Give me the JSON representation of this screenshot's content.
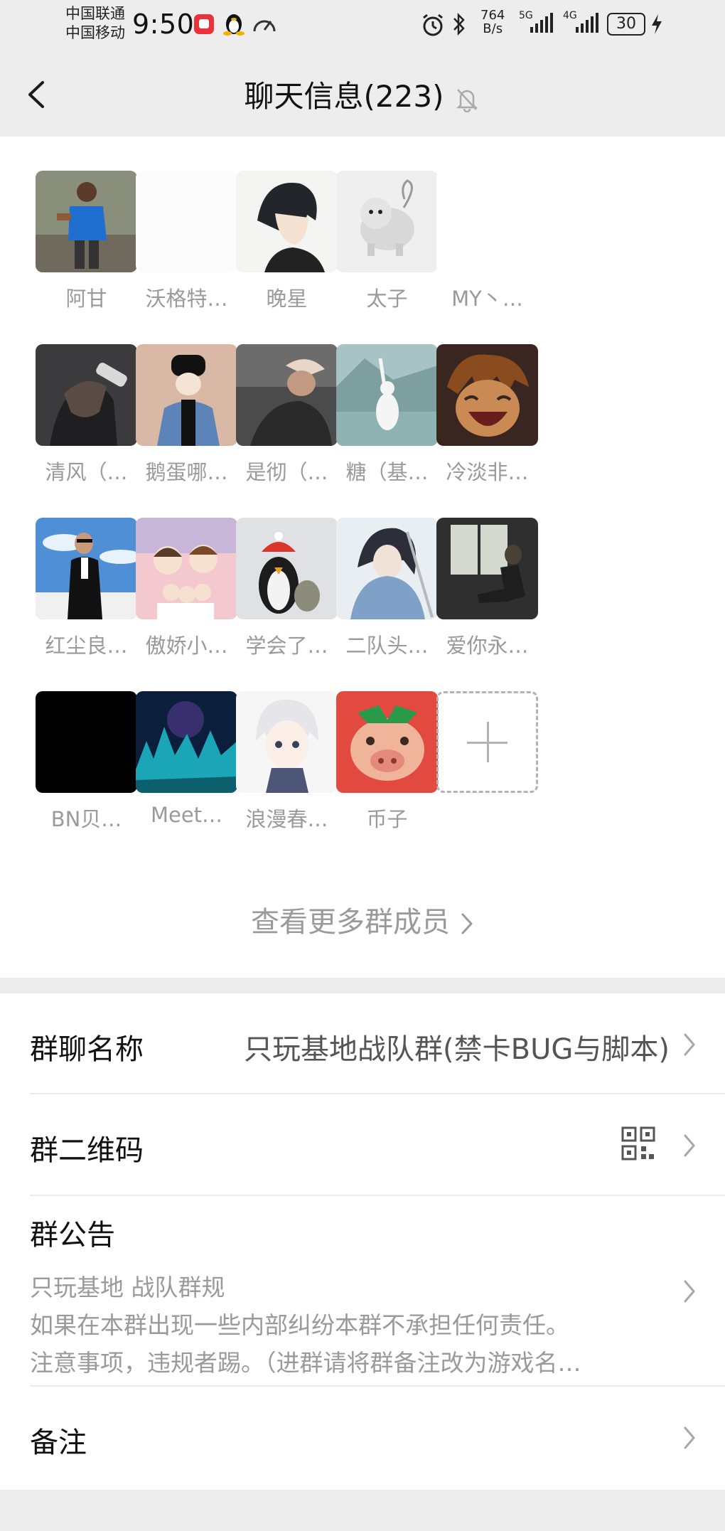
{
  "status_bar": {
    "carrier_1": "中国联通",
    "carrier_2": "中国移动",
    "time": "9:50",
    "speed_value": "764",
    "speed_unit": "B/s",
    "net_1": "5G",
    "net_2": "4G",
    "battery": "30"
  },
  "nav": {
    "title": "聊天信息(223)",
    "icons": {
      "back": "back-chevron-icon",
      "muted": "bell-muted-icon"
    }
  },
  "members": [
    {
      "name": "阿甘",
      "avatar": "photo-man-running-blue-shirt"
    },
    {
      "name": "沃格特…",
      "avatar": "blank-white"
    },
    {
      "name": "晚星",
      "avatar": "anime-dark-hair-boy"
    },
    {
      "name": "太子",
      "avatar": "cartoon-shiba-dog"
    },
    {
      "name": "MY丶…",
      "avatar": "none"
    },
    {
      "name": "清风（…",
      "avatar": "dark-anime-hand-on-head"
    },
    {
      "name": "鹅蛋哪…",
      "avatar": "illustration-girl-denim-jacket"
    },
    {
      "name": "是彻（…",
      "avatar": "photo-man-white-cap"
    },
    {
      "name": "糖（基…",
      "avatar": "photo-girl-lake"
    },
    {
      "name": "冷淡非…",
      "avatar": "anime-orange-hair-laughing"
    },
    {
      "name": "红尘良…",
      "avatar": "photo-man-tuxedo-boat"
    },
    {
      "name": "傲娇小…",
      "avatar": "cartoon-family-pink-sky"
    },
    {
      "name": "学会了…",
      "avatar": "photo-penguin-plush"
    },
    {
      "name": "二队头…",
      "avatar": "anime-swordsman-scarf"
    },
    {
      "name": "爱你永…",
      "avatar": "photo-man-window-sitting"
    },
    {
      "name": "BN贝…",
      "avatar": "solid-black"
    },
    {
      "name": "Meet…",
      "avatar": "neon-fantasy-city"
    },
    {
      "name": "浪漫春…",
      "avatar": "anime-white-hair-boy"
    },
    {
      "name": "币子",
      "avatar": "cartoon-red-pig-face"
    }
  ],
  "add_member": {
    "icon": "plus-icon"
  },
  "view_more": "查看更多群成员",
  "settings": {
    "group_name_label": "群聊名称",
    "group_name_value": "只玩基地战队群(禁卡BUG与脚本)",
    "qr_label": "群二维码",
    "qr_icon": "qr-code-icon",
    "notice_label": "群公告",
    "notice_lines": [
      "只玩基地 战队群规",
      "如果在本群出现一些内部纠纷本群不承担任何责任。",
      "注意事项，违规者踢。（进群请将群备注改为游戏名…"
    ],
    "remark_label": "备注"
  },
  "colors": {
    "background": "#ededed",
    "card": "#ffffff",
    "muted_text": "#9a9a9a"
  }
}
